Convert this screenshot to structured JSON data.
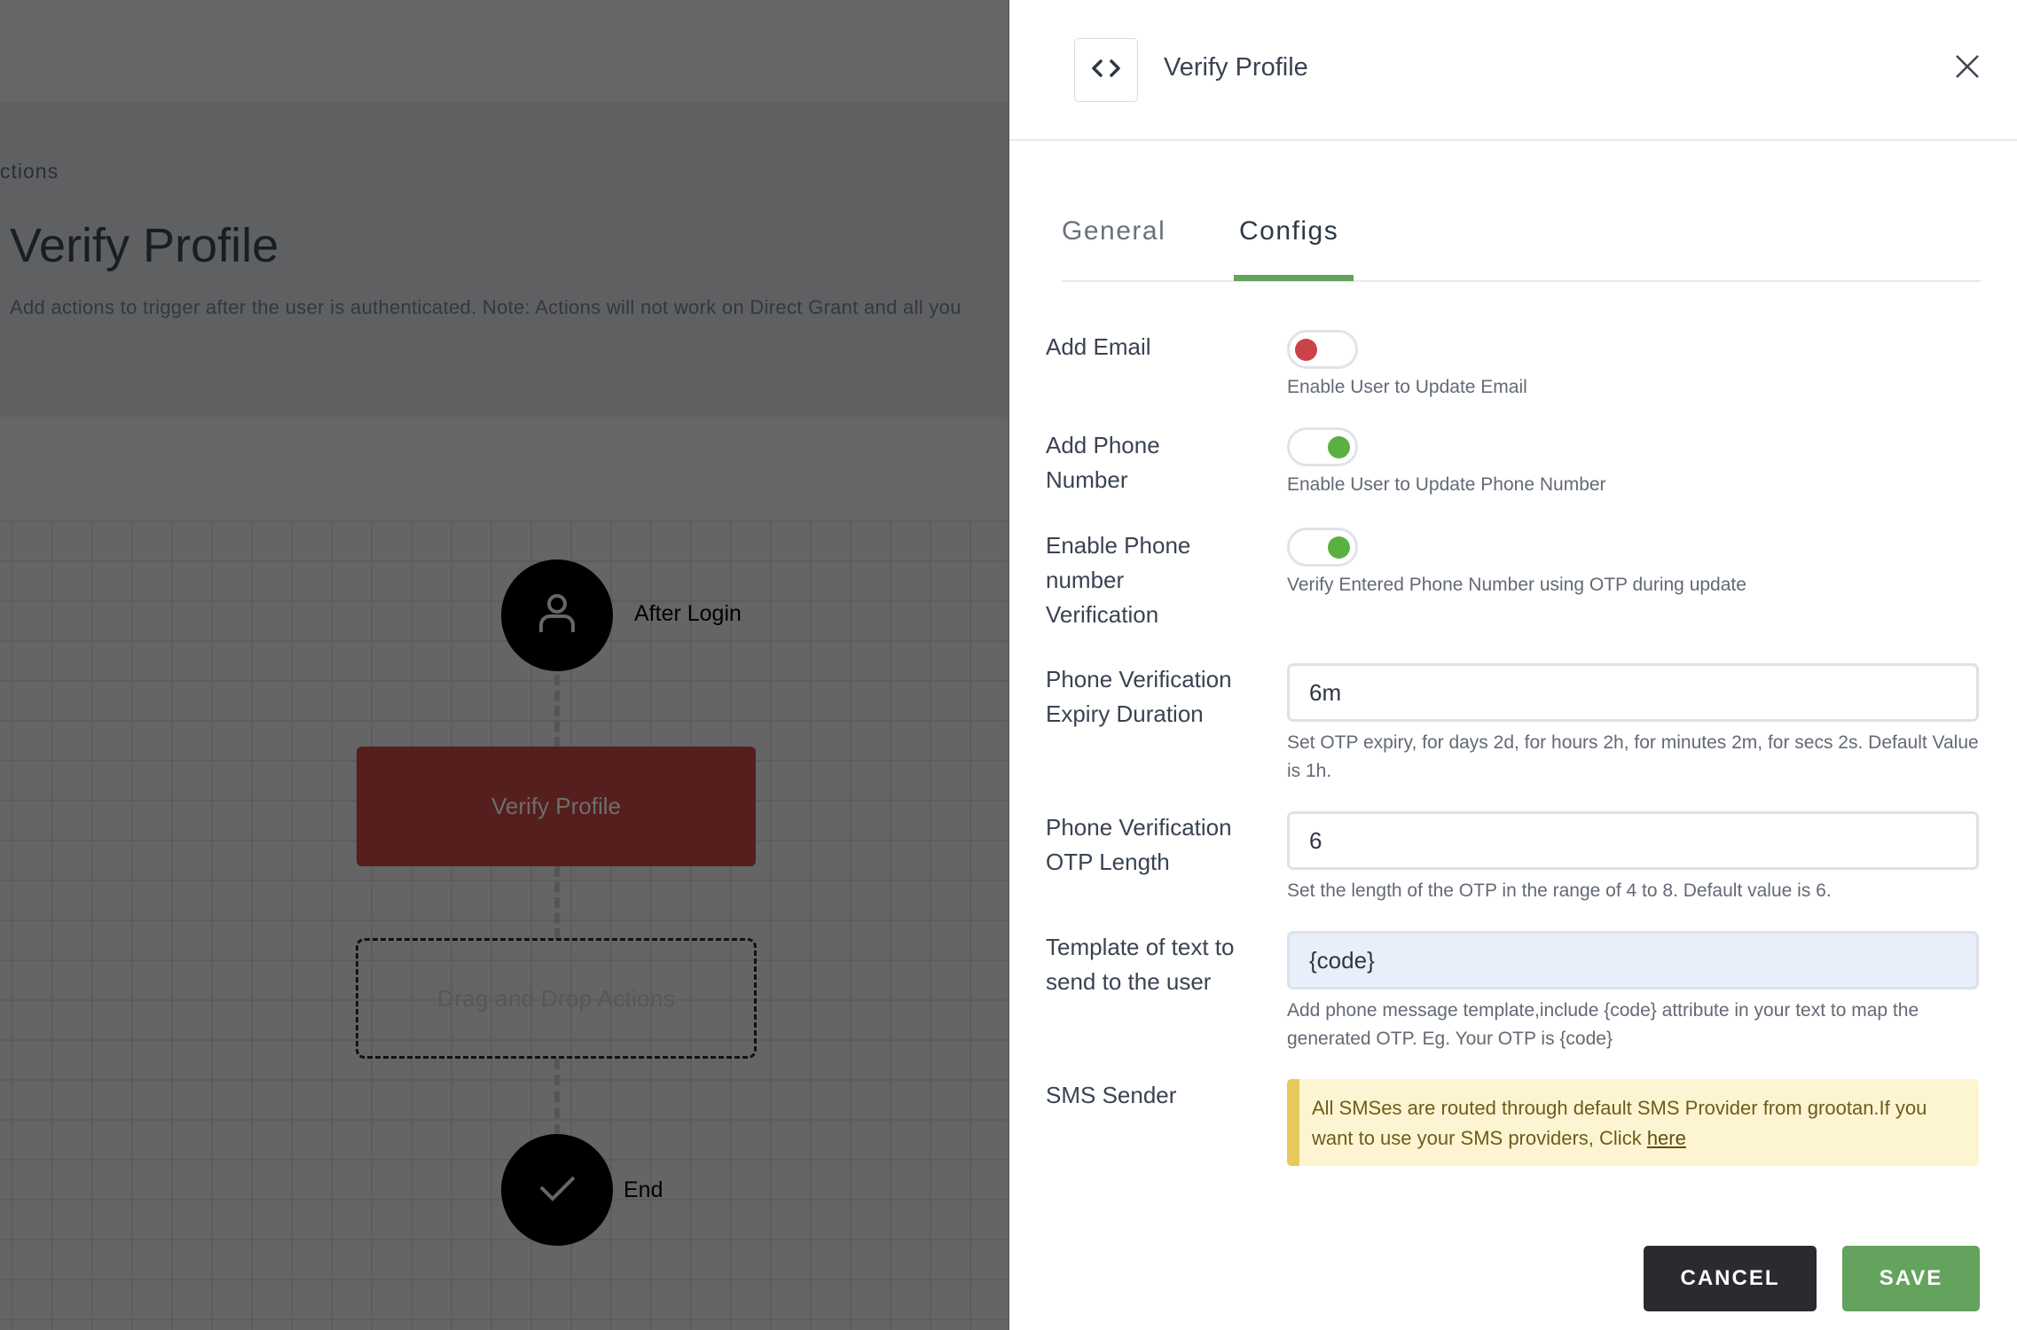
{
  "background": {
    "breadcrumb": "ctions",
    "title": "Verify Profile",
    "description": "Add actions to trigger after the user is authenticated. Note: Actions will not work on Direct Grant and all you",
    "flow": {
      "start_node": {
        "label": "After Login",
        "icon": "user-icon"
      },
      "action_node": {
        "label": "Verify Profile"
      },
      "drop_zone": {
        "label": "Drag and Drop Actions"
      },
      "end_node": {
        "label": "End",
        "icon": "check-icon"
      }
    }
  },
  "panel": {
    "header": {
      "icon": "code-brackets-icon",
      "title": "Verify Profile",
      "close_icon": "close-icon"
    },
    "tabs": [
      {
        "label": "General",
        "active": false
      },
      {
        "label": "Configs",
        "active": true
      }
    ],
    "fields": {
      "add_email": {
        "label": "Add Email",
        "enabled": false,
        "help": "Enable User to Update Email"
      },
      "add_phone": {
        "label": "Add Phone Number",
        "enabled": true,
        "help": "Enable User to Update Phone Number"
      },
      "phone_verification": {
        "label": "Enable Phone number Verification",
        "enabled": true,
        "help": "Verify Entered Phone Number using OTP during update"
      },
      "expiry_duration": {
        "label": "Phone Verification Expiry Duration",
        "value": "6m",
        "help": "Set OTP expiry, for days 2d, for hours 2h, for minutes 2m, for secs 2s. Default Value is 1h."
      },
      "otp_length": {
        "label": "Phone Verification OTP Length",
        "value": "6",
        "help": "Set the length of the OTP in the range of 4 to 8. Default value is 6."
      },
      "template": {
        "label": "Template of text to send to the user",
        "value": "{code}",
        "help": "Add phone message template,include {code} attribute in your text to map the generated OTP. Eg. Your OTP is {code}"
      },
      "sms_sender": {
        "label": "SMS Sender",
        "alert_text": "All SMSes are routed through default SMS Provider from grootan.If you want to use your SMS providers, Click ",
        "alert_link": "here"
      }
    },
    "buttons": {
      "cancel": "CANCEL",
      "save": "SAVE"
    }
  },
  "colors": {
    "accent_green": "#63a35d",
    "toggle_on": "#5bb042",
    "toggle_off": "#cc4249",
    "action_node": "#551f1d",
    "alert_bg": "#fdf5d2",
    "alert_border": "#e6c95a"
  }
}
